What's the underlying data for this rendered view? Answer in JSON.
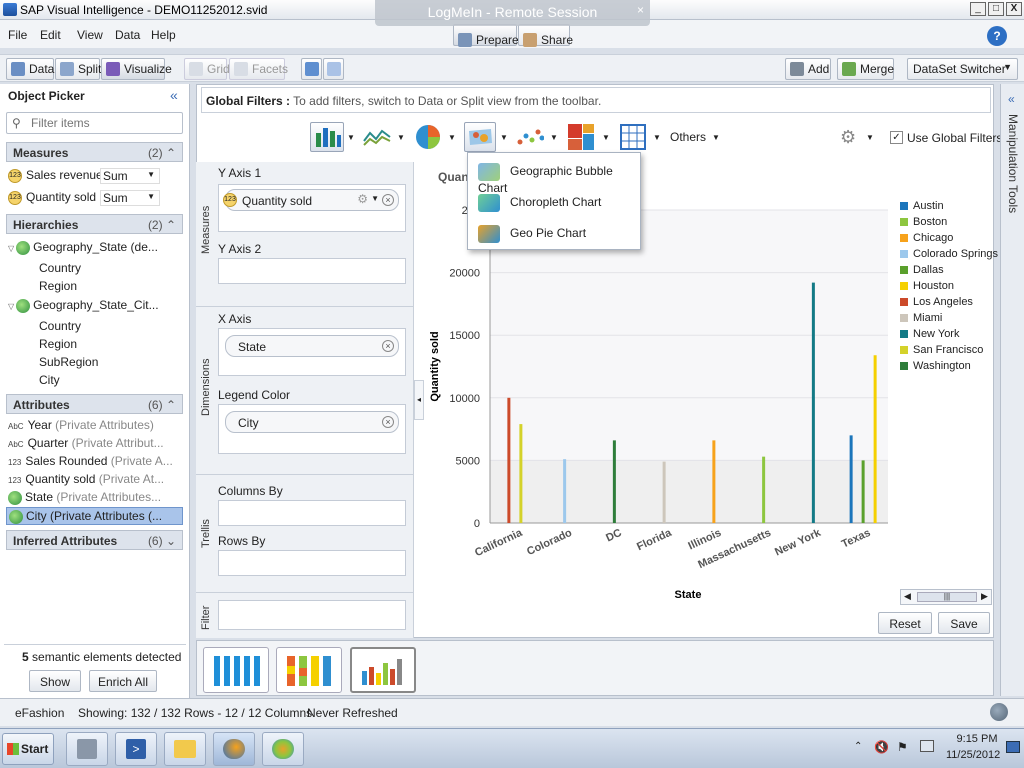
{
  "window": {
    "title": "SAP Visual Intelligence - DEMO11252012.svid",
    "remote_session": "LogMeIn - Remote Session",
    "min": "_",
    "max": "□",
    "close": "X"
  },
  "menu": {
    "file": "File",
    "edit": "Edit",
    "view": "View",
    "data": "Data",
    "help": "Help",
    "prepare": "Prepare",
    "share": "Share",
    "help_icon": "?"
  },
  "toolbar": {
    "data": "Data",
    "split": "Split",
    "visualize": "Visualize",
    "grid": "Grid",
    "facets": "Facets",
    "add": "Add",
    "merge": "Merge",
    "dataset_switcher": "DataSet Switcher"
  },
  "object_picker": {
    "title": "Object Picker",
    "filter_placeholder": "Filter items",
    "measures_title": "Measures",
    "measures_count": "(2)",
    "measures": [
      {
        "name": "Sales revenue",
        "agg": "Sum"
      },
      {
        "name": "Quantity sold",
        "agg": "Sum"
      }
    ],
    "hierarchies_title": "Hierarchies",
    "hierarchies_count": "(2)",
    "hierarchy1": "Geography_State (de...",
    "hierarchy1_levels": [
      "Country",
      "Region"
    ],
    "hierarchy2": "Geography_State_Cit...",
    "hierarchy2_levels": [
      "Country",
      "Region",
      "SubRegion",
      "City"
    ],
    "attributes_title": "Attributes",
    "attributes_count": "(6)",
    "attributes": [
      {
        "type": "AbC",
        "name": "Year",
        "detail": "(Private Attributes)"
      },
      {
        "type": "AbC",
        "name": "Quarter",
        "detail": "(Private Attribut..."
      },
      {
        "type": "123",
        "name": "Sales Rounded",
        "detail": "(Private A..."
      },
      {
        "type": "123",
        "name": "Quantity sold",
        "detail": "(Private At..."
      },
      {
        "type": "geo",
        "name": "State",
        "detail": "(Private Attributes..."
      },
      {
        "type": "geo",
        "name": "City",
        "detail": "(Private Attributes (..."
      }
    ],
    "inferred_title": "Inferred Attributes",
    "inferred_count": "(6)",
    "semantic_count": "5",
    "semantic_text": "semantic elements detected",
    "show": "Show",
    "enrich_all": "Enrich All"
  },
  "global_filters": {
    "label": "Global Filters :",
    "hint": "To add filters, switch to Data or Split view from the toolbar."
  },
  "chart_toolbar": {
    "others": "Others",
    "use_global_filters": "Use Global Filters"
  },
  "chart_menu": [
    "Geographic Bubble Chart",
    "Choropleth Chart",
    "Geo Pie Chart"
  ],
  "feeding": {
    "measures_label": "Measures",
    "dimensions_label": "Dimensions",
    "trellis_label": "Trellis",
    "filter_label": "Filter",
    "y1": "Y Axis 1",
    "y1_value": "Quantity sold",
    "y2": "Y Axis 2",
    "x": "X Axis",
    "x_value": "State",
    "legend": "Legend Color",
    "legend_value": "City",
    "columns": "Columns By",
    "rows": "Rows By"
  },
  "chart_title": "Quan",
  "chart_data": {
    "type": "bar",
    "xlabel": "State",
    "ylabel": "Quantity sold",
    "ylim": [
      0,
      25000
    ],
    "yticks": [
      0,
      5000,
      10000,
      15000,
      20000,
      25000
    ],
    "ytick_labels": [
      "0",
      "5000",
      "10000",
      "15000",
      "20000",
      "250"
    ],
    "categories": [
      "California",
      "Colorado",
      "DC",
      "Florida",
      "Illinois",
      "Massachusetts",
      "New York",
      "Texas"
    ],
    "series": [
      {
        "name": "Austin",
        "color": "#1b75bb",
        "values": [
          0,
          0,
          0,
          0,
          0,
          0,
          0,
          7000
        ]
      },
      {
        "name": "Boston",
        "color": "#8dc63f",
        "values": [
          0,
          0,
          0,
          0,
          0,
          5300,
          0,
          0
        ]
      },
      {
        "name": "Chicago",
        "color": "#f7a21b",
        "values": [
          0,
          0,
          0,
          0,
          6600,
          0,
          0,
          0
        ]
      },
      {
        "name": "Colorado Springs",
        "color": "#9cc8ec",
        "values": [
          0,
          5100,
          0,
          0,
          0,
          0,
          0,
          0
        ]
      },
      {
        "name": "Dallas",
        "color": "#5aa02c",
        "values": [
          0,
          0,
          0,
          0,
          0,
          0,
          0,
          5000
        ]
      },
      {
        "name": "Houston",
        "color": "#f5d000",
        "values": [
          0,
          0,
          0,
          0,
          0,
          0,
          0,
          13400
        ]
      },
      {
        "name": "Los Angeles",
        "color": "#cc4a2a",
        "values": [
          10000,
          0,
          0,
          0,
          0,
          0,
          0,
          0
        ]
      },
      {
        "name": "Miami",
        "color": "#cdc6bb",
        "values": [
          0,
          0,
          0,
          4900,
          0,
          0,
          0,
          0
        ]
      },
      {
        "name": "New York",
        "color": "#137a86",
        "values": [
          0,
          0,
          0,
          0,
          0,
          0,
          19200,
          0
        ]
      },
      {
        "name": "San Francisco",
        "color": "#d4d22a",
        "values": [
          7900,
          0,
          0,
          0,
          0,
          0,
          0,
          0
        ]
      },
      {
        "name": "Washington",
        "color": "#2e7d3a",
        "values": [
          0,
          0,
          6600,
          0,
          0,
          0,
          0,
          0
        ]
      }
    ]
  },
  "chart_actions": {
    "reset": "Reset",
    "save": "Save"
  },
  "manipulation_tools": "Manipulation Tools",
  "status": {
    "source": "eFashion",
    "showing": "Showing: 132 / 132 Rows - 12 / 12 Columns",
    "refresh": "Never Refreshed"
  },
  "taskbar": {
    "start": "Start",
    "time": "9:15 PM",
    "date": "11/25/2012"
  }
}
